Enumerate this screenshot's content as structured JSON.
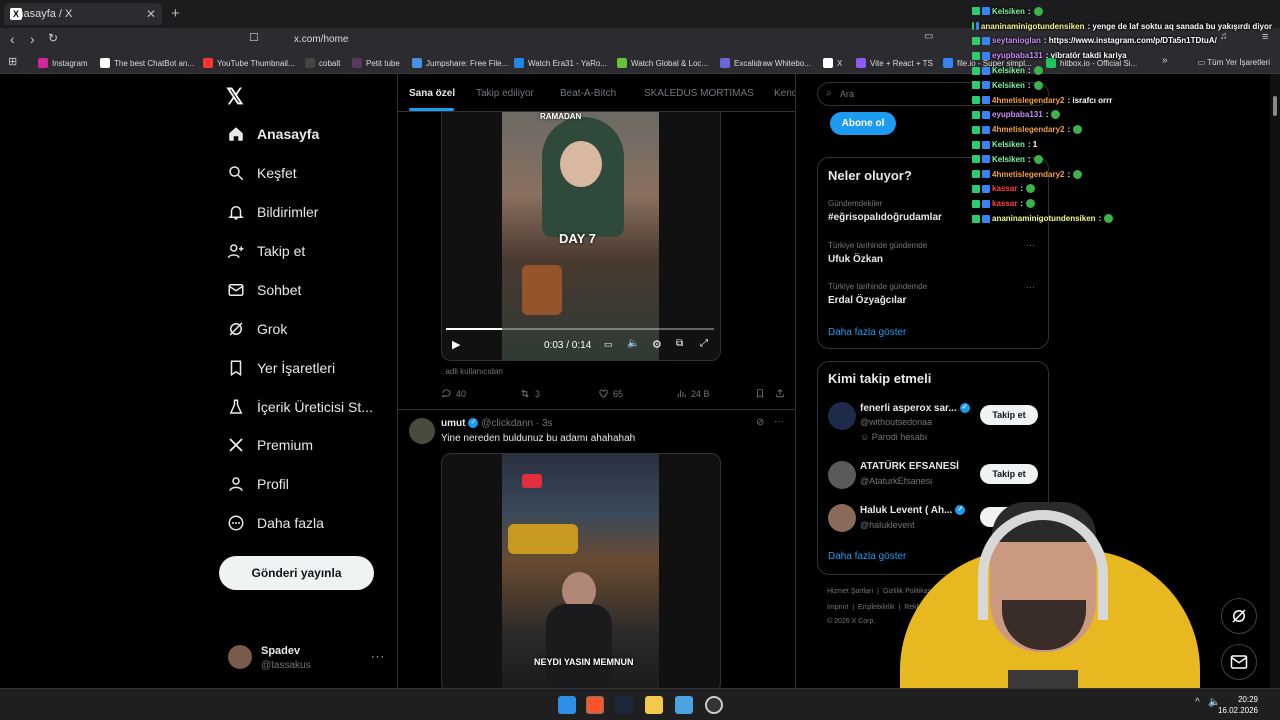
{
  "browser": {
    "tab_title": "Anasayfa / X",
    "url": "x.com/home",
    "bookmarks": [
      "Instagram",
      "The best ChatBot an...",
      "YouTube Thumbnail...",
      "cobalt",
      "Petit tube",
      "Jumpshare: Free File...",
      "Watch Era31 - YaRo...",
      "Watch Global & Loc...",
      "Excalidraw Whitebo...",
      "X",
      "Vite + React + TS",
      "file.io - Super simpl...",
      "hitbox.io - Official Si..."
    ],
    "bookmarks_other": "Tüm Yer İşaretleri"
  },
  "nav": {
    "items": [
      {
        "label": "Anasayfa",
        "icon": "home-icon"
      },
      {
        "label": "Keşfet",
        "icon": "search-icon"
      },
      {
        "label": "Bildirimler",
        "icon": "bell-icon"
      },
      {
        "label": "Takip et",
        "icon": "add-user-icon"
      },
      {
        "label": "Sohbet",
        "icon": "mail-icon"
      },
      {
        "label": "Grok",
        "icon": "grok-icon"
      },
      {
        "label": "Yer İşaretleri",
        "icon": "bookmark-icon"
      },
      {
        "label": "İçerik Üreticisi St...",
        "icon": "flask-icon"
      },
      {
        "label": "Premium",
        "icon": "x-icon"
      },
      {
        "label": "Profil",
        "icon": "user-icon"
      },
      {
        "label": "Daha fazla",
        "icon": "more-circle-icon"
      }
    ],
    "post_button": "Gönderi yayınla",
    "profile": {
      "name": "Spadev",
      "handle": "@tassakus",
      "more": "···"
    }
  },
  "feed": {
    "tabs": [
      "Sana özel",
      "Takip ediliyor",
      "Beat-A-Bitch",
      "SKALEDUS MORTIMAS",
      "Kend"
    ],
    "post1": {
      "video_overlay_top": "RAMADAN",
      "video_overlay_mid": "DAY 7",
      "time": "0:03 / 0:14",
      "progress": 0.21,
      "caption": ". adli kullanıcıdan",
      "stats": {
        "replies": "40",
        "reposts": "3",
        "likes": "65",
        "views": "24 B"
      }
    },
    "post2": {
      "author": "umut",
      "handle": "@clickdann",
      "time": "· 3s",
      "text": "Yine nereden buldunuz bu adamı ahahahah",
      "video_caption": "NEYDI YASIN MEMNUN"
    }
  },
  "sidebar": {
    "search_placeholder": "Ara",
    "subscribe": "Abone ol",
    "trends": {
      "title": "Neler oluyor?",
      "items": [
        {
          "context": "Gündemdekiler",
          "name": "#eğrisopalıdoğrudamlar"
        },
        {
          "context": "Türkiye tarihinde gündemde",
          "name": "Ufuk Özkan"
        },
        {
          "context": "Türkiye tarihinde gündemde",
          "name": "Erdal Özyağcılar"
        }
      ],
      "more": "Daha fazla göster"
    },
    "who_to_follow": {
      "title": "Kimi takip etmeli",
      "items": [
        {
          "name": "fenerli asperox sar...",
          "handle": "@withoutsedonaa",
          "note": "Parodi hesabı",
          "button": "Takip et"
        },
        {
          "name": "ATATÜRK EFSANESİ",
          "handle": "@AtaturkEfsanesi",
          "button": "Takip et"
        },
        {
          "name": "Haluk Levent ( Ah...",
          "handle": "@haluklevent",
          "button": "Ta"
        }
      ],
      "more": "Daha fazla göster"
    },
    "footer": {
      "line1": [
        "Hizmet Şartları",
        "Gizlilik Politikası"
      ],
      "line2": [
        "İmprint",
        "Erişilebilirlik",
        "Reklam"
      ],
      "copyright": "© 2026 X Corp."
    }
  },
  "chat": [
    {
      "user": "Kelsiken",
      "color": "#7ef5a6",
      "msg": ":",
      "emote": true
    },
    {
      "user": "ananinaminigotundensiken",
      "color": "#f6f78a",
      "msg": ": yenge de laf soktu aq sanada bu yakışırdı diyor",
      "emote": false
    },
    {
      "user": "seytanioglan",
      "color": "#c88df5",
      "msg": ": https://www.instagram.com/p/DTa5n1TDtuA/",
      "emote": false
    },
    {
      "user": "eyupbaba131",
      "color": "#c88df5",
      "msg": ": vibratör takdi kariya",
      "emote": false
    },
    {
      "user": "Kelsiken",
      "color": "#7ef5a6",
      "msg": ":",
      "emote": true
    },
    {
      "user": "Kelsiken",
      "color": "#7ef5a6",
      "msg": ":",
      "emote": true
    },
    {
      "user": "4hmetislegendary2",
      "color": "#f0a040",
      "msg": ": israfcı orrr",
      "emote": false
    },
    {
      "user": "eyupbaba131",
      "color": "#c88df5",
      "msg": ":",
      "emote": true
    },
    {
      "user": "4hmetislegendary2",
      "color": "#f0a040",
      "msg": ":",
      "emote": true
    },
    {
      "user": "Kelsiken",
      "color": "#7ef5a6",
      "msg": ": 1",
      "emote": false
    },
    {
      "user": "Kelsiken",
      "color": "#7ef5a6",
      "msg": ":",
      "emote": true
    },
    {
      "user": "4hmetislegendary2",
      "color": "#f0a040",
      "msg": ":",
      "emote": true
    },
    {
      "user": "kassar",
      "color": "#ff4040",
      "msg": ":",
      "emote": true
    },
    {
      "user": "kassar",
      "color": "#ff4040",
      "msg": ":",
      "emote": true
    },
    {
      "user": "ananinaminigotundensiken",
      "color": "#f6f78a",
      "msg": ":",
      "emote": true
    }
  ],
  "clock": {
    "time": "20:29",
    "date": "16.02.2026"
  }
}
